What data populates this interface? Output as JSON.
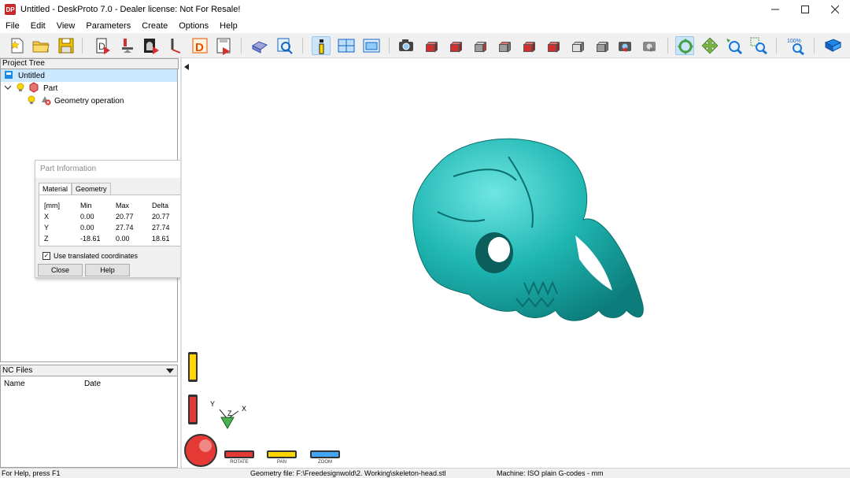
{
  "window": {
    "title": "Untitled - DeskProto 7.0 - Dealer license: Not For Resale!",
    "app_icon_text": "DP",
    "minimize_icon": "minimize-icon",
    "maximize_icon": "maximize-icon",
    "close_icon": "close-icon"
  },
  "menu": [
    "File",
    "Edit",
    "View",
    "Parameters",
    "Create",
    "Options",
    "Help"
  ],
  "toolbar": {
    "zoom_percent_label": "100%"
  },
  "project_tree": {
    "header": "Project Tree",
    "items": [
      {
        "label": "Untitled",
        "icon": "project-icon"
      },
      {
        "label": "Part",
        "icon": "part-icon"
      },
      {
        "label": "Geometry operation",
        "icon": "geometry-operation-icon"
      }
    ]
  },
  "nc_files": {
    "header": "NC Files",
    "columns": [
      "Name",
      "Date"
    ]
  },
  "part_info": {
    "title": "Part Information",
    "tabs": [
      "Material",
      "Geometry"
    ],
    "header_row": [
      "[mm]",
      "Min",
      "Max",
      "Delta"
    ],
    "rows": [
      [
        "X",
        "0.00",
        "20.77",
        "20.77"
      ],
      [
        "Y",
        "0.00",
        "27.74",
        "27.74"
      ],
      [
        "Z",
        "-18.61",
        "0.00",
        "18.61"
      ]
    ],
    "checkbox_label": "Use translated coordinates",
    "checkbox_checked": true,
    "close_label": "Close",
    "help_label": "Help"
  },
  "viewport": {
    "axes": {
      "y": "Y",
      "z": "Z",
      "x": "X"
    },
    "model_color": "#1fb6b2",
    "controls": [
      "ROTATE",
      "PAN",
      "ZOOM"
    ]
  },
  "status": {
    "help": "For Help, press F1",
    "geometry": "Geometry file: F:\\Freedesignwold\\2. Working\\skeleton-head.stl",
    "machine": "Machine: ISO plain G-codes - mm"
  }
}
